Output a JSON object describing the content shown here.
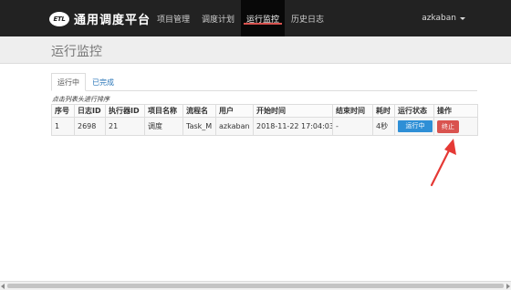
{
  "app": {
    "logo_mark": "ETL",
    "title": "通用调度平台"
  },
  "nav": {
    "items": [
      {
        "label": "项目管理",
        "active": false
      },
      {
        "label": "调度计划",
        "active": false
      },
      {
        "label": "运行监控",
        "active": true
      },
      {
        "label": "历史日志",
        "active": false
      }
    ]
  },
  "user": {
    "name": "azkaban",
    "icon": "chevron-down-icon"
  },
  "page": {
    "title": "运行监控"
  },
  "tabs": [
    {
      "label": "运行中",
      "active": true
    },
    {
      "label": "已完成",
      "active": false
    }
  ],
  "table": {
    "hint": "点击列表头进行排序",
    "columns": [
      "序号",
      "日志ID",
      "执行器ID",
      "项目名称",
      "流程名",
      "用户",
      "开始时间",
      "结束时间",
      "耗时",
      "运行状态",
      "操作"
    ],
    "rows": [
      {
        "index": "1",
        "log_id": "2698",
        "executor_id": "21",
        "project": "调度",
        "flow": "Task_M",
        "user": "azkaban",
        "start_time": "2018-11-22 17:04:03",
        "end_time": "-",
        "duration": "4秒",
        "status": "运行中",
        "action": "终止"
      }
    ]
  },
  "colors": {
    "topbar": "#222222",
    "accent_red": "#d9534f",
    "status_blue": "#2e8fd6",
    "link_blue": "#2a76b8",
    "annotation_arrow": "#e53935"
  }
}
